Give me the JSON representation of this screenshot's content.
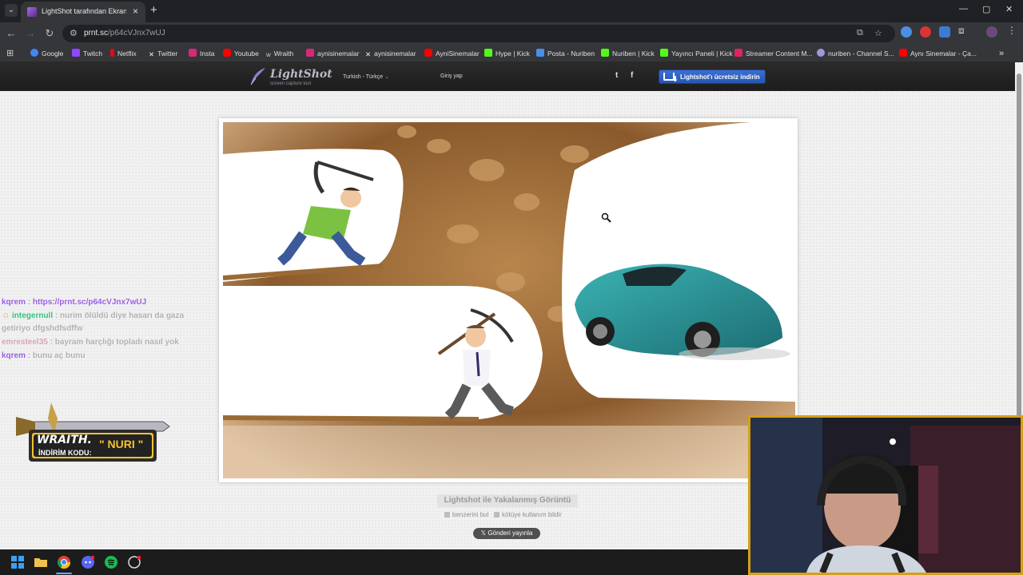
{
  "browser": {
    "tab_title": "LightShot tarafından Ekran Görüntüsü",
    "new_tab": "+",
    "url_domain": "prnt.sc",
    "url_path": "/p64cVJnx7wUJ"
  },
  "bookmarks": [
    {
      "label": "Google",
      "icon_color": "#4285f4"
    },
    {
      "label": "Twitch",
      "icon_color": "#9146ff"
    },
    {
      "label": "Netflix",
      "icon_color": "#e50914"
    },
    {
      "label": "Twitter",
      "icon_color": "#e7e7e7"
    },
    {
      "label": "Insta",
      "icon_color": "#d62976"
    },
    {
      "label": "Youtube",
      "icon_color": "#ff0000"
    },
    {
      "label": "Wraith",
      "icon_color": "#cccccc"
    },
    {
      "label": "aynisinemalar",
      "icon_color": "#d62976"
    },
    {
      "label": "aynisinemalar",
      "icon_color": "#e7e7e7"
    },
    {
      "label": "AyniSinemalar",
      "icon_color": "#ff0000"
    },
    {
      "label": "Hype | Kick",
      "icon_color": "#53fc18"
    },
    {
      "label": "Posta - Nuriben",
      "icon_color": "#4a8fe7"
    },
    {
      "label": "Nuriben | Kick",
      "icon_color": "#53fc18"
    },
    {
      "label": "Yayıncı Paneli | Kick",
      "icon_color": "#53fc18"
    },
    {
      "label": "Streamer Content M...",
      "icon_color": "#e0245e"
    },
    {
      "label": "nuriben - Channel S...",
      "icon_color": "#9a9ad8"
    },
    {
      "label": "Aynı Sinemalar - Ça...",
      "icon_color": "#ff0000"
    }
  ],
  "lightshot": {
    "logo": "LightShot",
    "tagline": "screen capture tool",
    "language": "Turkish - Türkçe",
    "login": "Giriş yap",
    "twitter_glyph": "t",
    "facebook_glyph": "f",
    "download": "Lightshot'ı ücretsiz indirin",
    "caption": "Lightshot ile Yakalanmış Görüntü",
    "find_similar": "benzerini bul",
    "report_abuse": "kötüye kullanım bildir",
    "tweet": "Gönderi yayınla"
  },
  "chat": [
    {
      "user": "kqrem",
      "user_color": "#9b5de5",
      "sep": " : ",
      "text": "https://prnt.sc/p64cVJnx7wUJ",
      "text_color": "#9b5de5"
    },
    {
      "user": "integernull",
      "user_color": "#2ec27e",
      "sep": " : ",
      "text": "nurim ölüldü diye hasarı da gaza getiriyo dfgshdfsdffw",
      "text_color": ""
    },
    {
      "user": "emresteel35",
      "user_color": "#d6a0b8",
      "sep": " : ",
      "text": "bayram harçlığı topladı nasıl yok",
      "text_color": ""
    },
    {
      "user": "kqrem",
      "user_color": "#9b5de5",
      "sep": " : ",
      "text": "bunu aç bunu",
      "text_color": ""
    }
  ],
  "sponsor": {
    "brand": "WRAITH.",
    "code_label": "İNDİRİM KODU:",
    "code": "\" NURI \""
  },
  "colors": {
    "chrome_dark": "#202124",
    "lightshot_blue": "#2f63c4",
    "webcam_border": "#d4a017"
  }
}
